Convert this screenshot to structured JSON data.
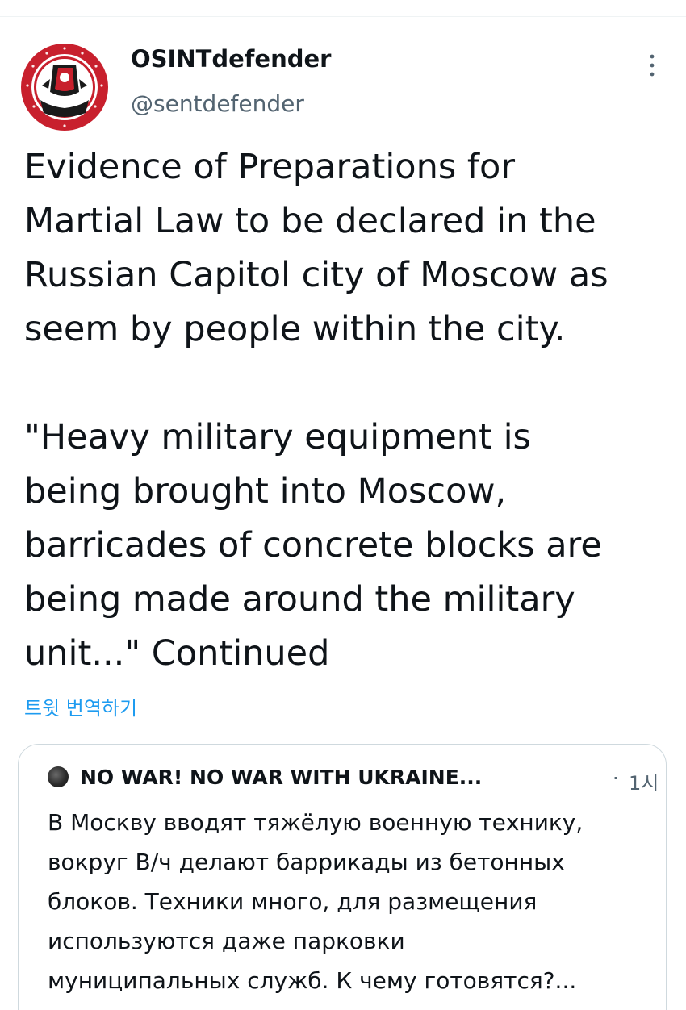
{
  "tweet": {
    "author": {
      "display_name": "OSINTdefender",
      "handle": "@sentdefender",
      "avatar_icon": "osintdefender-logo"
    },
    "text": "Evidence of Preparations for\nMartial Law to be declared in the\nRussian Capitol city of Moscow as\nseem by people within the city.\n\n\"Heavy military equipment is\nbeing brought into Moscow,\nbarricades of concrete blocks are\nbeing made around the military\nunit...\"      Continued",
    "translate_label": "트윗 번역하기"
  },
  "quote": {
    "author_name": "NO WAR! NO WAR WITH UKRAINE...",
    "separator": "·",
    "time": "1시",
    "text": "В Москву вводят тяжёлую военную технику,\nвокруг В/ч делают баррикады из бетонных\nблоков. Техники много, для размещения\nиспользуются даже парковки\nмуниципальных служб. К чему готовятся?..."
  },
  "colors": {
    "text_primary": "#0f1419",
    "text_secondary": "#536471",
    "link": "#1d9bf0",
    "border": "#cfd9de",
    "logo_red": "#c8202d"
  }
}
